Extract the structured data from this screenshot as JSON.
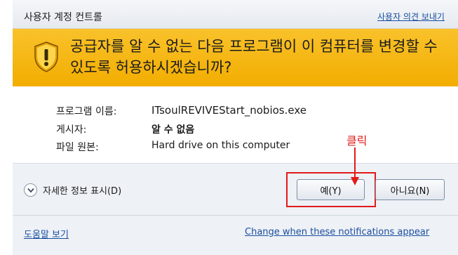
{
  "window": {
    "title": "사용자 계정 컨트롤",
    "feedback_link": "사용자 의견 보내기"
  },
  "banner": {
    "question": "공급자를 알 수 없는 다음 프로그램이 이 컴퓨터를 변경할 수 있도록 허용하시겠습니까?"
  },
  "details": {
    "program_name_label": "프로그램 이름:",
    "program_name_value": "ITsoulREVIVEStart_nobios.exe",
    "publisher_label": "게시자:",
    "publisher_value": "알 수 없음",
    "origin_label": "파일 원본:",
    "origin_value": "Hard drive on this computer"
  },
  "footer": {
    "show_details": "자세한 정보 표시(D)",
    "yes_button": "예(Y)",
    "no_button": "아니요(N)",
    "help_link": "도움말 보기",
    "change_link": "Change when these notifications appear"
  },
  "annotation": {
    "label": "클릭",
    "color": "#e21a1a"
  },
  "colors": {
    "banner": "#f6b400",
    "link": "#1a4fa0"
  }
}
